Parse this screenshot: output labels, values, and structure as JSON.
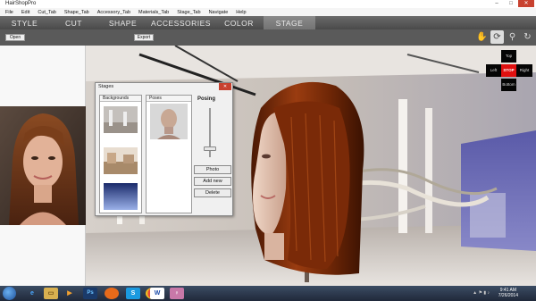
{
  "app": {
    "title": "HairShopPro",
    "window_buttons": [
      "–",
      "□",
      "✕"
    ]
  },
  "menu": {
    "items": [
      "File",
      "Edit",
      "Cut_Tab",
      "Shape_Tab",
      "Accessory_Tab",
      "Materials_Tab",
      "Stage_Tab",
      "Navigate",
      "Help"
    ]
  },
  "tabs": [
    {
      "label": "Style"
    },
    {
      "label": "Cut"
    },
    {
      "label": "Shape"
    },
    {
      "label": "Accessories"
    },
    {
      "label": "Color"
    },
    {
      "label": "Stage",
      "active": true
    }
  ],
  "toolbar": {
    "open_label": "Open",
    "export_label": "Export",
    "icons": [
      "hand-icon",
      "rotate-icon",
      "zoom-icon",
      "rotate-3d-icon"
    ]
  },
  "direction_pad": {
    "top": "Top",
    "left": "Left",
    "stop": "STOP",
    "right": "Right",
    "bottom": "Bottom"
  },
  "stages_dialog": {
    "title": "Stages",
    "close": "✕",
    "backgrounds_header": "Backgrounds",
    "poses_header": "Poses",
    "posing_label": "Posing",
    "photo_button": "Photo",
    "add_new_button": "Add new",
    "delete_button": "Delete"
  },
  "taskbar": {
    "apps": [
      "ie-icon",
      "folder-icon",
      "media-player-icon",
      "photoshop-icon",
      "firefox-icon",
      "skype-icon",
      "chrome-icon",
      "word-icon",
      "hairshop-icon"
    ],
    "time": "9:41 AM",
    "date": "7/26/2014"
  },
  "colors": {
    "tab_bar": "#5a5a5a",
    "stop": "#e01010",
    "hair": "#7a2a08"
  }
}
